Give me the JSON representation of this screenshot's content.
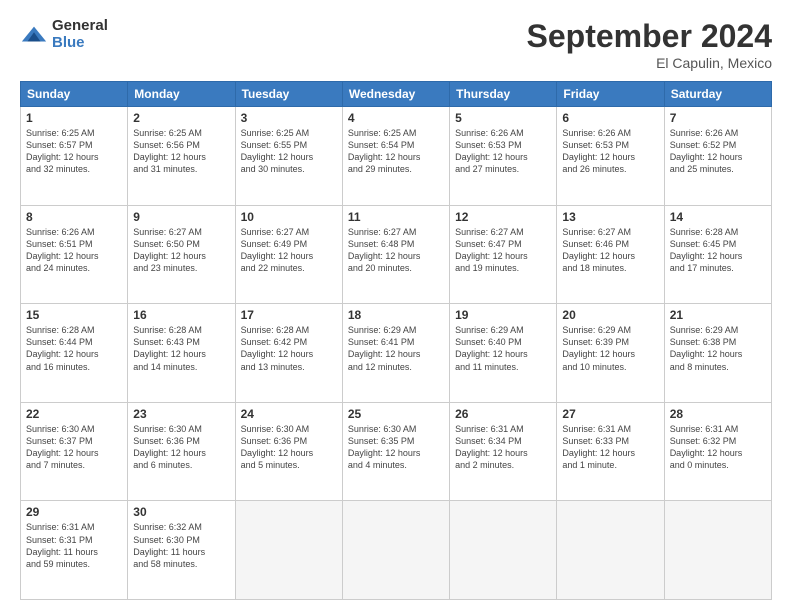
{
  "logo": {
    "general": "General",
    "blue": "Blue"
  },
  "header": {
    "month": "September 2024",
    "location": "El Capulin, Mexico"
  },
  "weekdays": [
    "Sunday",
    "Monday",
    "Tuesday",
    "Wednesday",
    "Thursday",
    "Friday",
    "Saturday"
  ],
  "weeks": [
    [
      {
        "day": "1",
        "info": "Sunrise: 6:25 AM\nSunset: 6:57 PM\nDaylight: 12 hours\nand 32 minutes."
      },
      {
        "day": "2",
        "info": "Sunrise: 6:25 AM\nSunset: 6:56 PM\nDaylight: 12 hours\nand 31 minutes."
      },
      {
        "day": "3",
        "info": "Sunrise: 6:25 AM\nSunset: 6:55 PM\nDaylight: 12 hours\nand 30 minutes."
      },
      {
        "day": "4",
        "info": "Sunrise: 6:25 AM\nSunset: 6:54 PM\nDaylight: 12 hours\nand 29 minutes."
      },
      {
        "day": "5",
        "info": "Sunrise: 6:26 AM\nSunset: 6:53 PM\nDaylight: 12 hours\nand 27 minutes."
      },
      {
        "day": "6",
        "info": "Sunrise: 6:26 AM\nSunset: 6:53 PM\nDaylight: 12 hours\nand 26 minutes."
      },
      {
        "day": "7",
        "info": "Sunrise: 6:26 AM\nSunset: 6:52 PM\nDaylight: 12 hours\nand 25 minutes."
      }
    ],
    [
      {
        "day": "8",
        "info": "Sunrise: 6:26 AM\nSunset: 6:51 PM\nDaylight: 12 hours\nand 24 minutes."
      },
      {
        "day": "9",
        "info": "Sunrise: 6:27 AM\nSunset: 6:50 PM\nDaylight: 12 hours\nand 23 minutes."
      },
      {
        "day": "10",
        "info": "Sunrise: 6:27 AM\nSunset: 6:49 PM\nDaylight: 12 hours\nand 22 minutes."
      },
      {
        "day": "11",
        "info": "Sunrise: 6:27 AM\nSunset: 6:48 PM\nDaylight: 12 hours\nand 20 minutes."
      },
      {
        "day": "12",
        "info": "Sunrise: 6:27 AM\nSunset: 6:47 PM\nDaylight: 12 hours\nand 19 minutes."
      },
      {
        "day": "13",
        "info": "Sunrise: 6:27 AM\nSunset: 6:46 PM\nDaylight: 12 hours\nand 18 minutes."
      },
      {
        "day": "14",
        "info": "Sunrise: 6:28 AM\nSunset: 6:45 PM\nDaylight: 12 hours\nand 17 minutes."
      }
    ],
    [
      {
        "day": "15",
        "info": "Sunrise: 6:28 AM\nSunset: 6:44 PM\nDaylight: 12 hours\nand 16 minutes."
      },
      {
        "day": "16",
        "info": "Sunrise: 6:28 AM\nSunset: 6:43 PM\nDaylight: 12 hours\nand 14 minutes."
      },
      {
        "day": "17",
        "info": "Sunrise: 6:28 AM\nSunset: 6:42 PM\nDaylight: 12 hours\nand 13 minutes."
      },
      {
        "day": "18",
        "info": "Sunrise: 6:29 AM\nSunset: 6:41 PM\nDaylight: 12 hours\nand 12 minutes."
      },
      {
        "day": "19",
        "info": "Sunrise: 6:29 AM\nSunset: 6:40 PM\nDaylight: 12 hours\nand 11 minutes."
      },
      {
        "day": "20",
        "info": "Sunrise: 6:29 AM\nSunset: 6:39 PM\nDaylight: 12 hours\nand 10 minutes."
      },
      {
        "day": "21",
        "info": "Sunrise: 6:29 AM\nSunset: 6:38 PM\nDaylight: 12 hours\nand 8 minutes."
      }
    ],
    [
      {
        "day": "22",
        "info": "Sunrise: 6:30 AM\nSunset: 6:37 PM\nDaylight: 12 hours\nand 7 minutes."
      },
      {
        "day": "23",
        "info": "Sunrise: 6:30 AM\nSunset: 6:36 PM\nDaylight: 12 hours\nand 6 minutes."
      },
      {
        "day": "24",
        "info": "Sunrise: 6:30 AM\nSunset: 6:36 PM\nDaylight: 12 hours\nand 5 minutes."
      },
      {
        "day": "25",
        "info": "Sunrise: 6:30 AM\nSunset: 6:35 PM\nDaylight: 12 hours\nand 4 minutes."
      },
      {
        "day": "26",
        "info": "Sunrise: 6:31 AM\nSunset: 6:34 PM\nDaylight: 12 hours\nand 2 minutes."
      },
      {
        "day": "27",
        "info": "Sunrise: 6:31 AM\nSunset: 6:33 PM\nDaylight: 12 hours\nand 1 minute."
      },
      {
        "day": "28",
        "info": "Sunrise: 6:31 AM\nSunset: 6:32 PM\nDaylight: 12 hours\nand 0 minutes."
      }
    ],
    [
      {
        "day": "29",
        "info": "Sunrise: 6:31 AM\nSunset: 6:31 PM\nDaylight: 11 hours\nand 59 minutes."
      },
      {
        "day": "30",
        "info": "Sunrise: 6:32 AM\nSunset: 6:30 PM\nDaylight: 11 hours\nand 58 minutes."
      },
      {
        "day": "",
        "info": ""
      },
      {
        "day": "",
        "info": ""
      },
      {
        "day": "",
        "info": ""
      },
      {
        "day": "",
        "info": ""
      },
      {
        "day": "",
        "info": ""
      }
    ]
  ]
}
